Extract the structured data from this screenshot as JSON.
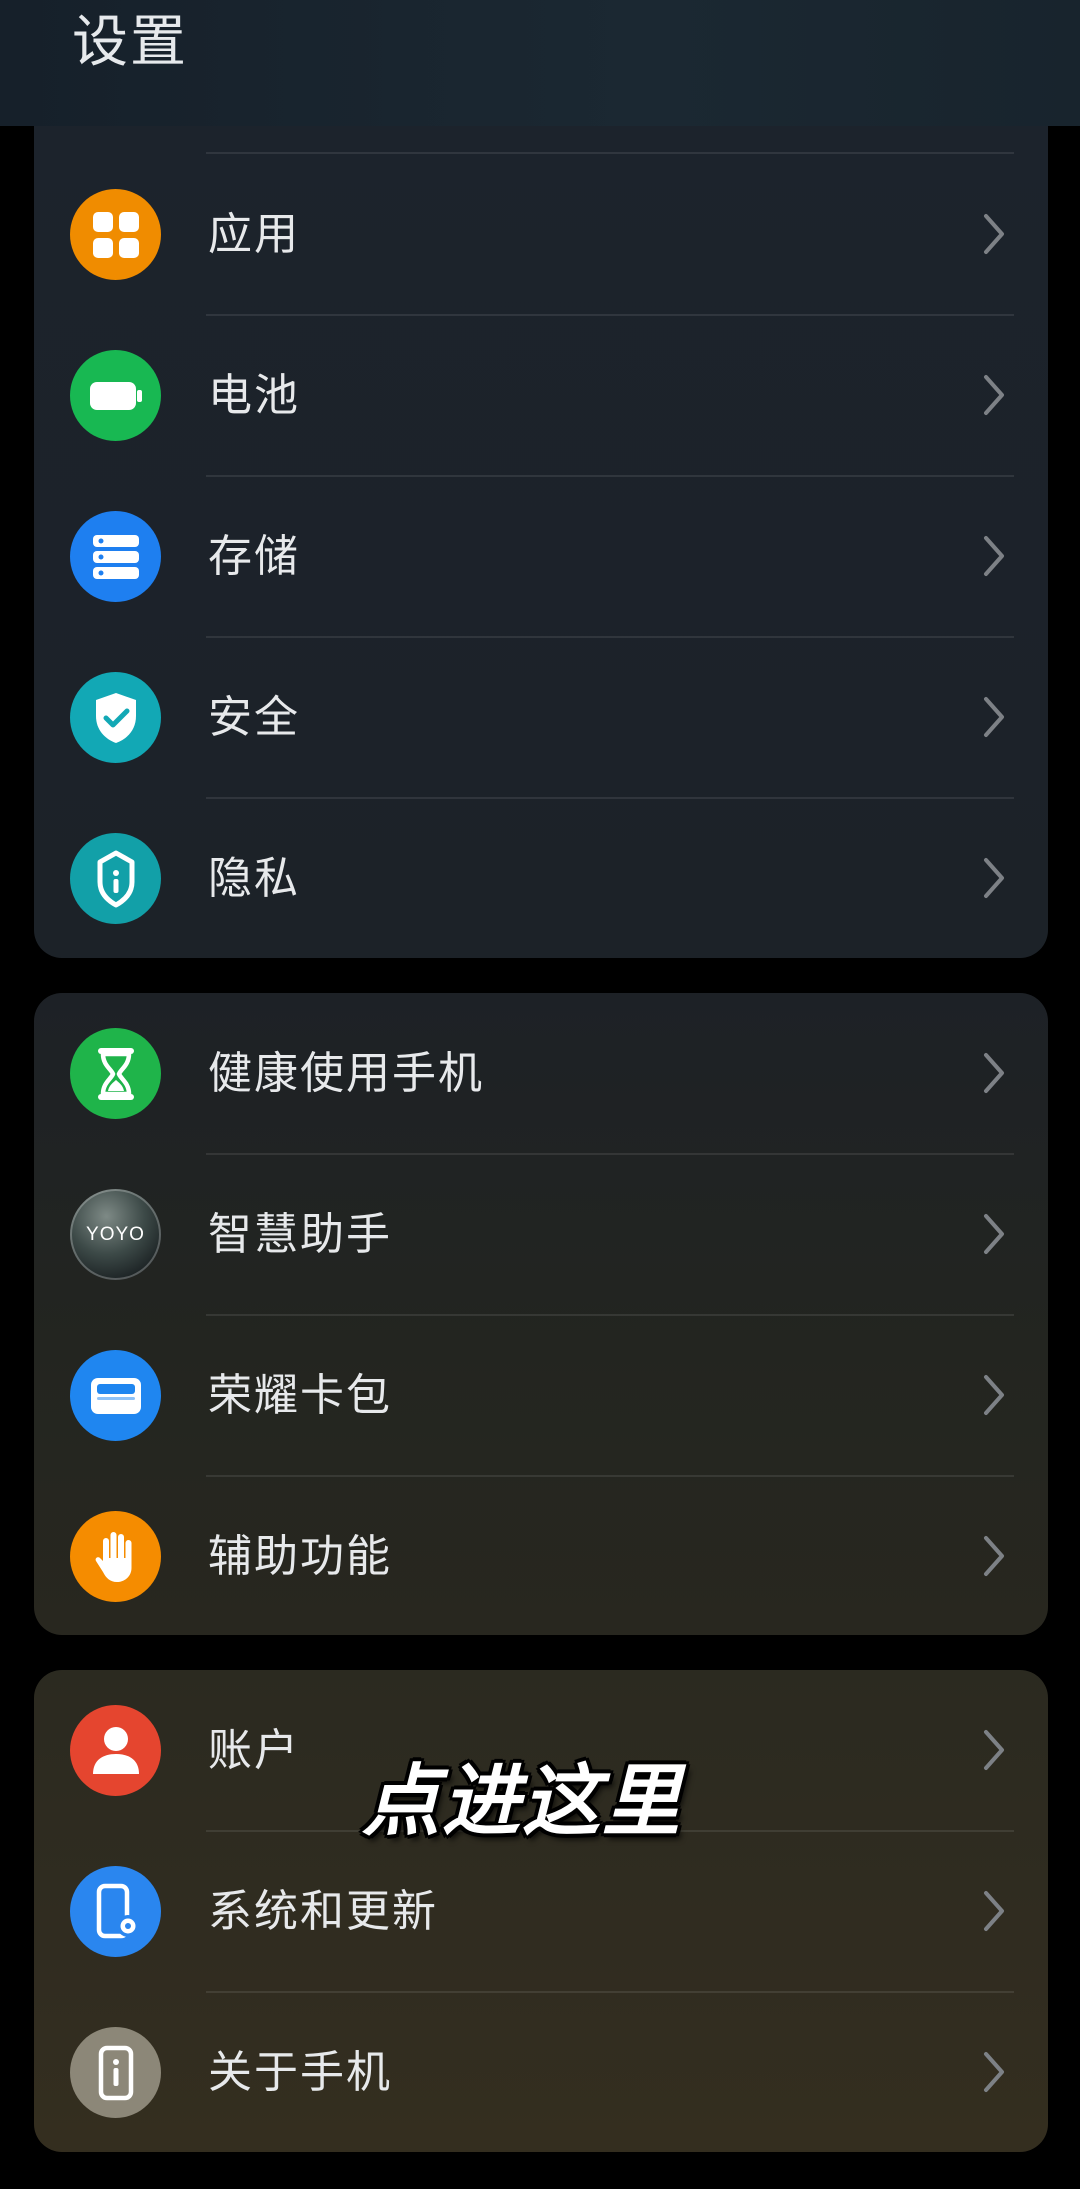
{
  "header": {
    "title": "设置"
  },
  "colors": {
    "apps": "#f08c00",
    "battery": "#18b852",
    "storage": "#1e7ff0",
    "security": "#12a8b5",
    "privacy": "#12a0a8",
    "health": "#1fb44a",
    "wallet": "#1f86f0",
    "accessibility": "#f58c00",
    "account": "#e5452f",
    "system": "#2a86ef",
    "about": "#8c8778"
  },
  "groups": [
    {
      "items": [
        {
          "label": "应用",
          "icon": "apps-grid-icon"
        },
        {
          "label": "电池",
          "icon": "battery-icon"
        },
        {
          "label": "存储",
          "icon": "storage-icon"
        },
        {
          "label": "安全",
          "icon": "shield-check-icon"
        },
        {
          "label": "隐私",
          "icon": "privacy-lock-icon"
        }
      ]
    },
    {
      "items": [
        {
          "label": "健康使用手机",
          "icon": "hourglass-icon"
        },
        {
          "label": "智慧助手",
          "icon": "yoyo-assistant-icon",
          "icon_text": "YOYO"
        },
        {
          "label": "荣耀卡包",
          "icon": "wallet-icon"
        },
        {
          "label": "辅助功能",
          "icon": "hand-icon"
        }
      ]
    },
    {
      "items": [
        {
          "label": "账户",
          "icon": "account-person-icon"
        },
        {
          "label": "系统和更新",
          "icon": "phone-settings-icon"
        },
        {
          "label": "关于手机",
          "icon": "info-phone-icon"
        }
      ]
    }
  ],
  "overlay": {
    "caption": "点进这里"
  }
}
